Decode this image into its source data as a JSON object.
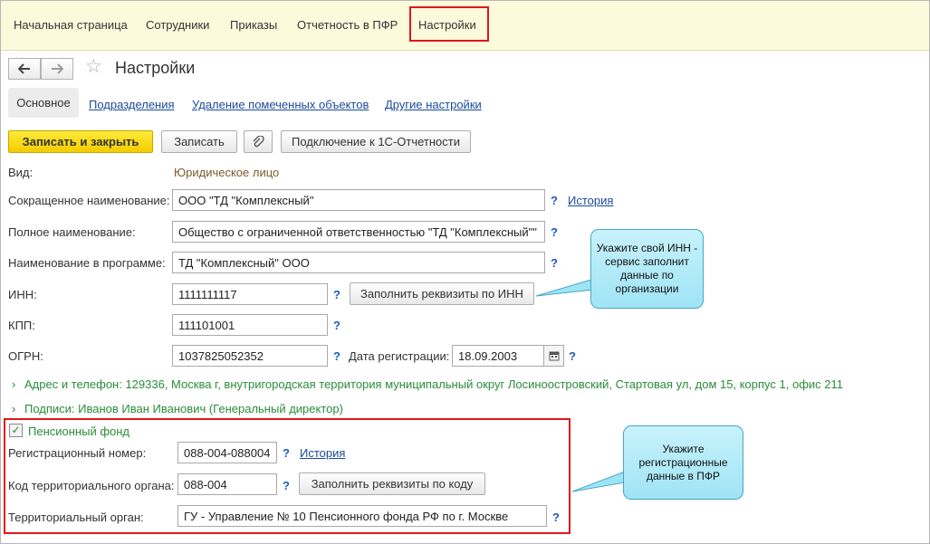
{
  "nav": {
    "items": [
      "Начальная страница",
      "Сотрудники",
      "Приказы",
      "Отчетность в ПФР",
      "Настройки"
    ]
  },
  "toolbar": {
    "back_icon": "arrow-left-icon",
    "forward_icon": "arrow-right-icon",
    "favorite_icon": "star-icon",
    "title": "Настройки"
  },
  "tabs": {
    "active": "Основное",
    "links": [
      "Подразделения",
      "Удаление помеченных объектов",
      "Другие настройки"
    ]
  },
  "actions": {
    "save_close": "Записать и закрыть",
    "save": "Записать",
    "attach_icon": "paperclip-icon",
    "connect": "Подключение к 1С-Отчетности"
  },
  "form": {
    "vid_label": "Вид:",
    "vid_value": "Юридическое лицо",
    "short_name_label": "Сокращенное наименование:",
    "short_name_value": "ООО \"ТД \"Комплексный\"",
    "history_link": "История",
    "full_name_label": "Полное наименование:",
    "full_name_value": "Общество с ограниченной ответственностью \"ТД \"Комплексный\"\"",
    "program_name_label": "Наименование в программе:",
    "program_name_value": "ТД \"Комплексный\" ООО",
    "inn_label": "ИНН:",
    "inn_value": "1111111117",
    "fill_by_inn": "Заполнить реквизиты по ИНН",
    "kpp_label": "КПП:",
    "kpp_value": "111101001",
    "ogrn_label": "ОГРН:",
    "ogrn_value": "1037825052352",
    "reg_date_label": "Дата регистрации:",
    "reg_date_value": "18.09.2003",
    "calendar_icon": "calendar-icon",
    "help": "?",
    "address_line": "Адрес и телефон: 129336, Москва г, внутригородская территория муниципальный округ Лосиноостровский, Стартовая ул, дом 15, корпус 1, офис 211",
    "signatures_line": "Подписи: Иванов Иван Иванович (Генеральный директор)"
  },
  "pension": {
    "group_title": "Пенсионный фонд",
    "checked": true,
    "reg_number_label": "Регистрационный номер:",
    "reg_number_value": "088-004-088004",
    "history_link": "История",
    "territorial_code_label": "Код территориального органа:",
    "territorial_code_value": "088-004",
    "fill_by_code": "Заполнить реквизиты по коду",
    "territorial_body_label": "Территориальный орган:",
    "territorial_body_value": "ГУ - Управление № 10 Пенсионного фонда РФ по г. Москве"
  },
  "callouts": {
    "inn_hint": "Укажите свой ИНН - сервис заполнит данные по организации",
    "pfr_hint": "Укажите регистрационные данные в ПФР"
  },
  "colors": {
    "topbar": "#fbfbdc",
    "highlight_red": "#e0161b",
    "primary_yellow": "#f3cc00",
    "link_blue": "#1a4a9c",
    "group_green": "#2a8c3a",
    "callout_cyan": "#9fe4f6"
  }
}
